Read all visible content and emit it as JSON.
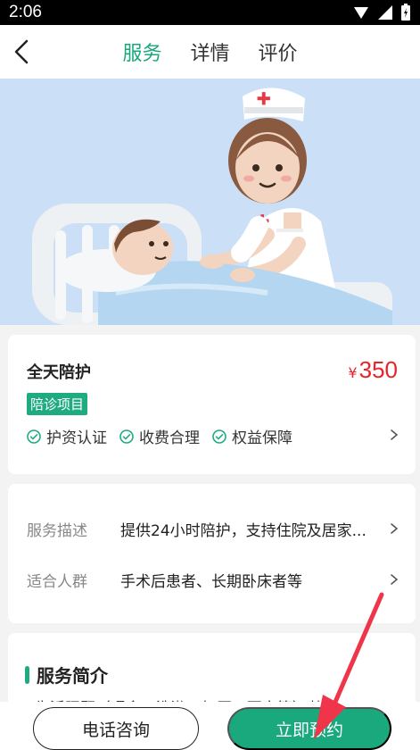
{
  "status_bar": {
    "time": "2:06"
  },
  "nav": {
    "tabs": [
      {
        "label": "服务",
        "active": true
      },
      {
        "label": "详情",
        "active": false
      },
      {
        "label": "评价",
        "active": false
      }
    ]
  },
  "hero": {
    "image": "nurse-caring-for-patient-illustration"
  },
  "service": {
    "title": "全天陪护",
    "price_symbol": "¥",
    "price": "350",
    "tag": "陪诊项目",
    "features": [
      "护资认证",
      "收费合理",
      "权益保障"
    ]
  },
  "details": {
    "rows": [
      {
        "label": "服务描述",
        "value": "提供24小时陪护，支持住院及居家..."
      },
      {
        "label": "适合人群",
        "value": "手术后患者、长期卧床者等"
      }
    ]
  },
  "intro": {
    "title": "服务简介",
    "text_partial": "· 生活照顾（喂食、洗漱、如厕、更衣等）· 协助"
  },
  "actions": {
    "call_label": "电话咨询",
    "book_label": "立即预约"
  },
  "colors": {
    "accent": "#1aa87d",
    "price": "#e8232a",
    "hero_bg": "#cbe0f7",
    "annotation_arrow": "#f0344a"
  }
}
